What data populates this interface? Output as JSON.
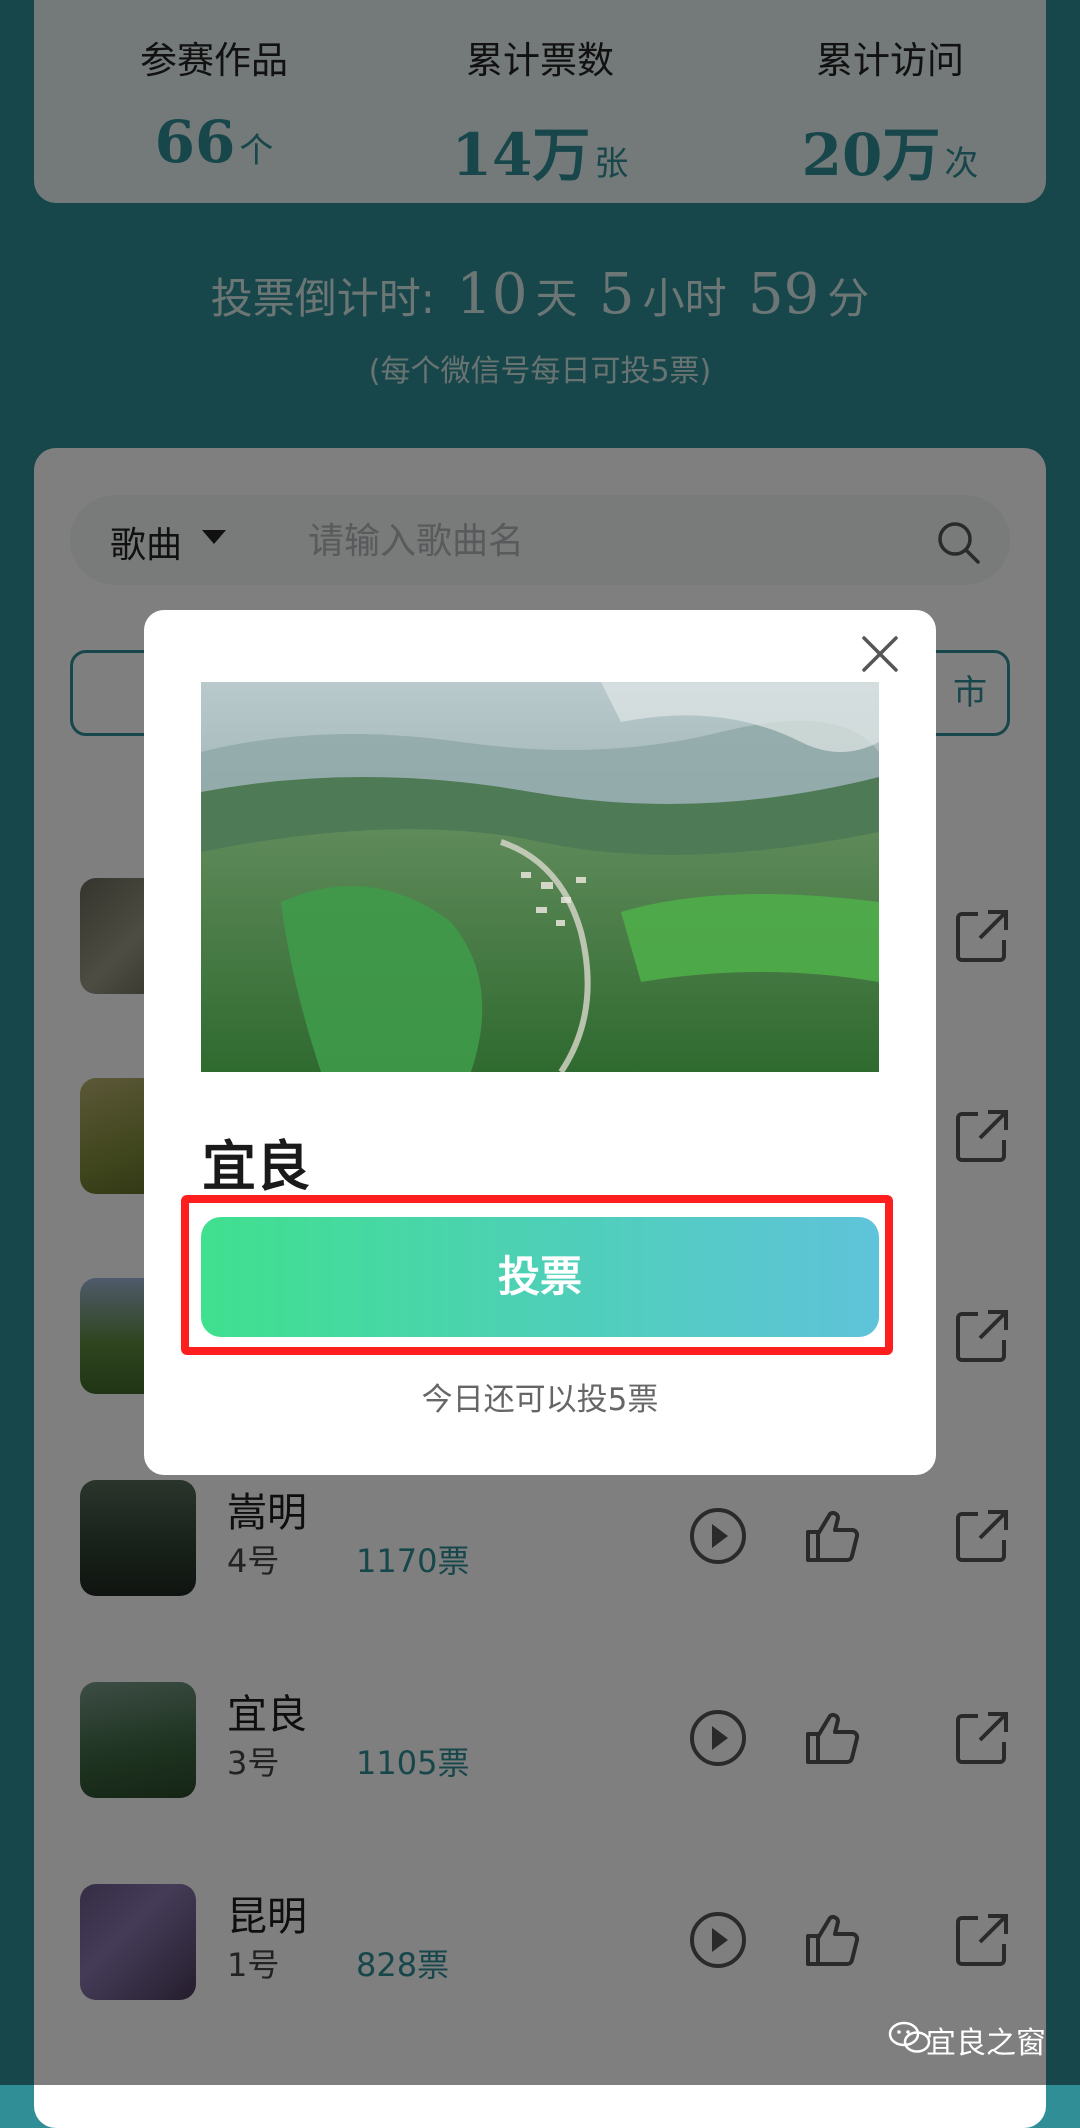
{
  "stats": [
    {
      "label": "参赛作品",
      "value": "66",
      "unit": "个"
    },
    {
      "label": "累计票数",
      "value": "14万",
      "unit": "张"
    },
    {
      "label": "累计访问",
      "value": "20万",
      "unit": "次"
    }
  ],
  "countdown": {
    "prefix": "投票倒计时:",
    "days": "10",
    "days_unit": "天",
    "hours": "5",
    "hours_unit": "小时",
    "minutes": "59",
    "minutes_unit": "分",
    "rule": "(每个微信号每日可投5票)"
  },
  "search": {
    "category": "歌曲",
    "placeholder": "请输入歌曲名"
  },
  "filters": {
    "right_partial": "市"
  },
  "entries": [
    {
      "name": "嵩明",
      "number": "4号",
      "votes": "1170票"
    },
    {
      "name": "宜良",
      "number": "3号",
      "votes": "1105票"
    },
    {
      "name": "昆明",
      "number": "1号",
      "votes": "828票"
    }
  ],
  "modal": {
    "title": "宜良",
    "vote_button": "投票",
    "remaining": "今日还可以投5票"
  },
  "watermark": "宜良之窗",
  "colors": {
    "accent": "#2f8e96",
    "vote_gradient_start": "#3fe08e",
    "vote_gradient_end": "#5fc3da",
    "highlight": "#ff1e1e"
  }
}
